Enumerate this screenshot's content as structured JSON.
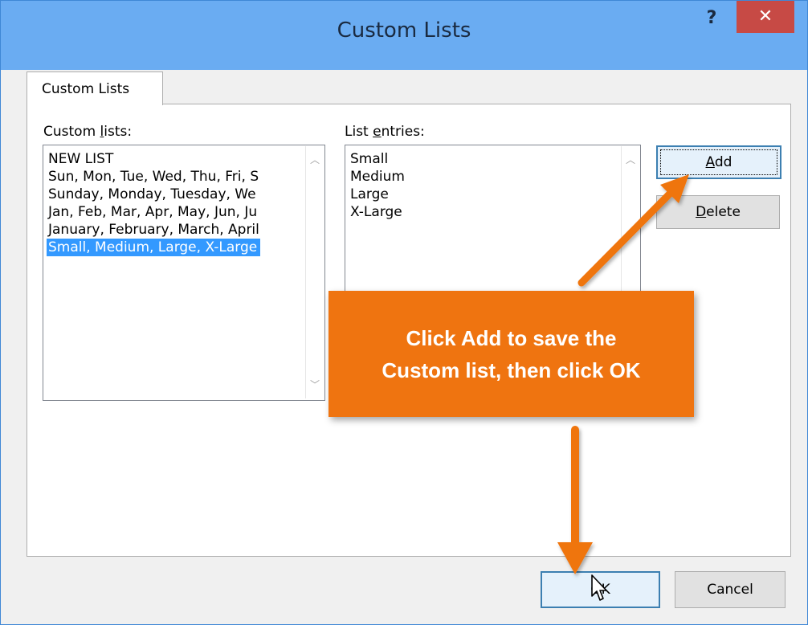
{
  "window": {
    "title": "Custom Lists",
    "help_label": "?",
    "close_label": "✕"
  },
  "tab": {
    "label": "Custom Lists"
  },
  "custom_lists": {
    "label_pre": "Custom ",
    "label_accel": "l",
    "label_post": "ists:",
    "items": [
      "NEW LIST",
      "Sun, Mon, Tue, Wed, Thu, Fri, S",
      "Sunday, Monday, Tuesday, We",
      "Jan, Feb, Mar, Apr, May, Jun, Ju",
      "January, February, March, April",
      "Small, Medium, Large, X-Large"
    ],
    "selected_index": 5
  },
  "list_entries": {
    "label_pre": "List ",
    "label_accel": "e",
    "label_post": "ntries:",
    "items": [
      "Small",
      "Medium",
      "Large",
      "X-Large"
    ]
  },
  "buttons": {
    "add_accel": "A",
    "add_rest": "dd",
    "delete_accel": "D",
    "delete_rest": "elete",
    "ok": "OK",
    "cancel": "Cancel"
  },
  "callout": {
    "line1": "Click Add to save the",
    "line2": "Custom list, then click OK"
  },
  "colors": {
    "titlebar": "#6aacf2",
    "close": "#c74a45",
    "selection": "#3399ff",
    "callout": "#ef7410"
  }
}
